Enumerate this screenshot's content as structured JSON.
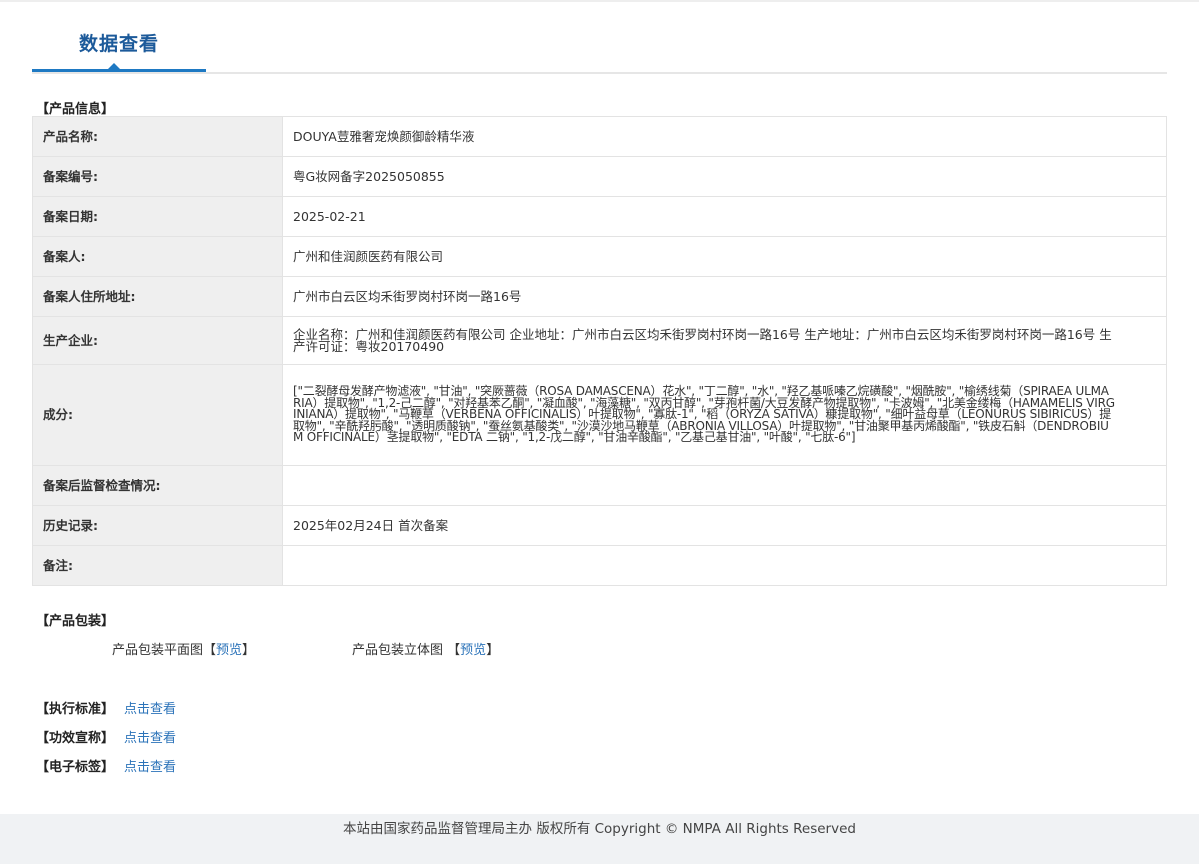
{
  "tab": {
    "title": "数据查看"
  },
  "product_info": {
    "section_title": "【产品信息】",
    "rows": [
      {
        "label": "产品名称:",
        "value": "DOUYA荳雅奢宠焕颜御龄精华液"
      },
      {
        "label": "备案编号:",
        "value": "粤G妆网备字2025050855"
      },
      {
        "label": "备案日期:",
        "value": "2025-02-21"
      },
      {
        "label": "备案人:",
        "value": "广州和佳润颜医药有限公司"
      },
      {
        "label": "备案人住所地址:",
        "value": "广州市白云区均禾街罗岗村环岗一路16号"
      },
      {
        "label": "生产企业:",
        "value": "企业名称：广州和佳润颜医药有限公司 企业地址：广州市白云区均禾街罗岗村环岗一路16号 生产地址：广州市白云区均禾街罗岗村环岗一路16号 生产许可证：粤妆20170490"
      },
      {
        "label": "成分:",
        "value": "[\"二裂酵母发酵产物滤液\", \"甘油\", \"突厥蔷薇（ROSA DAMASCENA）花水\", \"丁二醇\", \"水\", \"羟乙基哌嗪乙烷磺酸\", \"烟酰胺\", \"榆绣线菊（SPIRAEA ULMARIA）提取物\", \"1,2-己二醇\", \"对羟基苯乙酮\", \"凝血酸\", \"海藻糖\", \"双丙甘醇\", \"芽孢杆菌/大豆发酵产物提取物\", \"卡波姆\", \"北美金缕梅（HAMAMELIS VIRGINIANA）提取物\", \"马鞭草（VERBENA OFFICINALIS）叶提取物\", \"寡肽-1\", \"稻（ORYZA SATIVA）糠提取物\", \"细叶益母草（LEONURUS SIBIRICUS）提取物\", \"辛酰羟肟酸\", \"透明质酸钠\", \"蚕丝氨基酸类\", \"沙漠沙地马鞭草（ABRONIA VILLOSA）叶提取物\", \"甘油聚甲基丙烯酸酯\", \"铁皮石斛（DENDROBIUM OFFICINALE）茎提取物\", \"EDTA 二钠\", \"1,2-戊二醇\", \"甘油辛酸酯\", \"乙基己基甘油\", \"叶酸\", \"七肽-6\"]"
      },
      {
        "label": "备案后监督检查情况:",
        "value": ""
      },
      {
        "label": "历史记录:",
        "value": "2025年02月24日 首次备案"
      },
      {
        "label": "备注:",
        "value": ""
      }
    ]
  },
  "packaging": {
    "section_title": "【产品包装】",
    "flat_label": "产品包装平面图",
    "stereo_label": "产品包装立体图",
    "bracket_open": "【",
    "bracket_close": "】",
    "preview_text": "预览"
  },
  "standards": [
    {
      "label": "【执行标准】",
      "link": "点击查看"
    },
    {
      "label": "【功效宣称】",
      "link": "点击查看"
    },
    {
      "label": "【电子标签】",
      "link": "点击查看"
    }
  ],
  "footer": {
    "text": "本站由国家药品监督管理局主办 版权所有 Copyright © NMPA All Rights Reserved"
  },
  "colors": {
    "accent": "#1e79c3",
    "link": "#2b73b9",
    "label_bg": "#efefef",
    "table_border": "#a9c4e0",
    "footer_bg": "#f0f2f4"
  }
}
